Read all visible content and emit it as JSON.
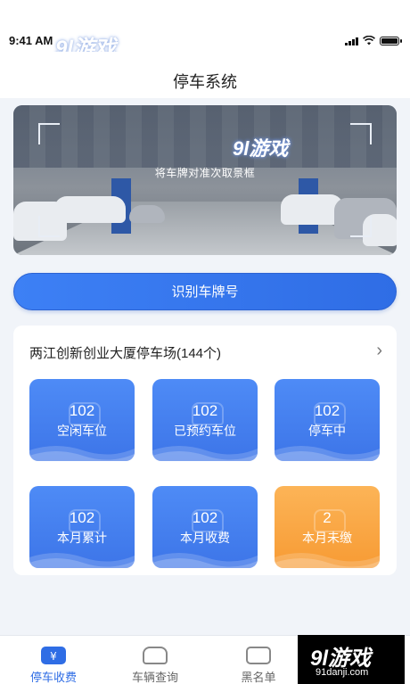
{
  "status_bar": {
    "time": "9:41 AM"
  },
  "watermark": {
    "brand": "9l游戏",
    "url": "91danji.com"
  },
  "header": {
    "title": "停车系统"
  },
  "camera": {
    "hint": "将车牌对准次取景框"
  },
  "actions": {
    "recognize_label": "识别车牌号"
  },
  "lot": {
    "name": "两江创新创业大厦停车场(144个)",
    "chevron": "›",
    "stats": [
      {
        "value": "102",
        "label": "空闲车位",
        "color": "#3d75e8"
      },
      {
        "value": "102",
        "label": "已预约车位",
        "color": "#3d75e8"
      },
      {
        "value": "102",
        "label": "停车中",
        "color": "#3d75e8"
      },
      {
        "value": "102",
        "label": "本月累计",
        "color": "#3d75e8"
      },
      {
        "value": "102",
        "label": "本月收费",
        "color": "#3d75e8"
      },
      {
        "value": "2",
        "label": "本月未缴",
        "color": "#f79b34"
      }
    ]
  },
  "bottom_nav": {
    "items": [
      {
        "label": "停车收费",
        "icon": "parking-fee-icon",
        "active": true
      },
      {
        "label": "车辆查询",
        "icon": "car-search-icon",
        "active": false
      },
      {
        "label": "黑名单",
        "icon": "blacklist-icon",
        "active": false
      }
    ]
  },
  "colors": {
    "primary": "#2f6de5",
    "accent_orange": "#f79b34",
    "background": "#f1f4f9"
  }
}
